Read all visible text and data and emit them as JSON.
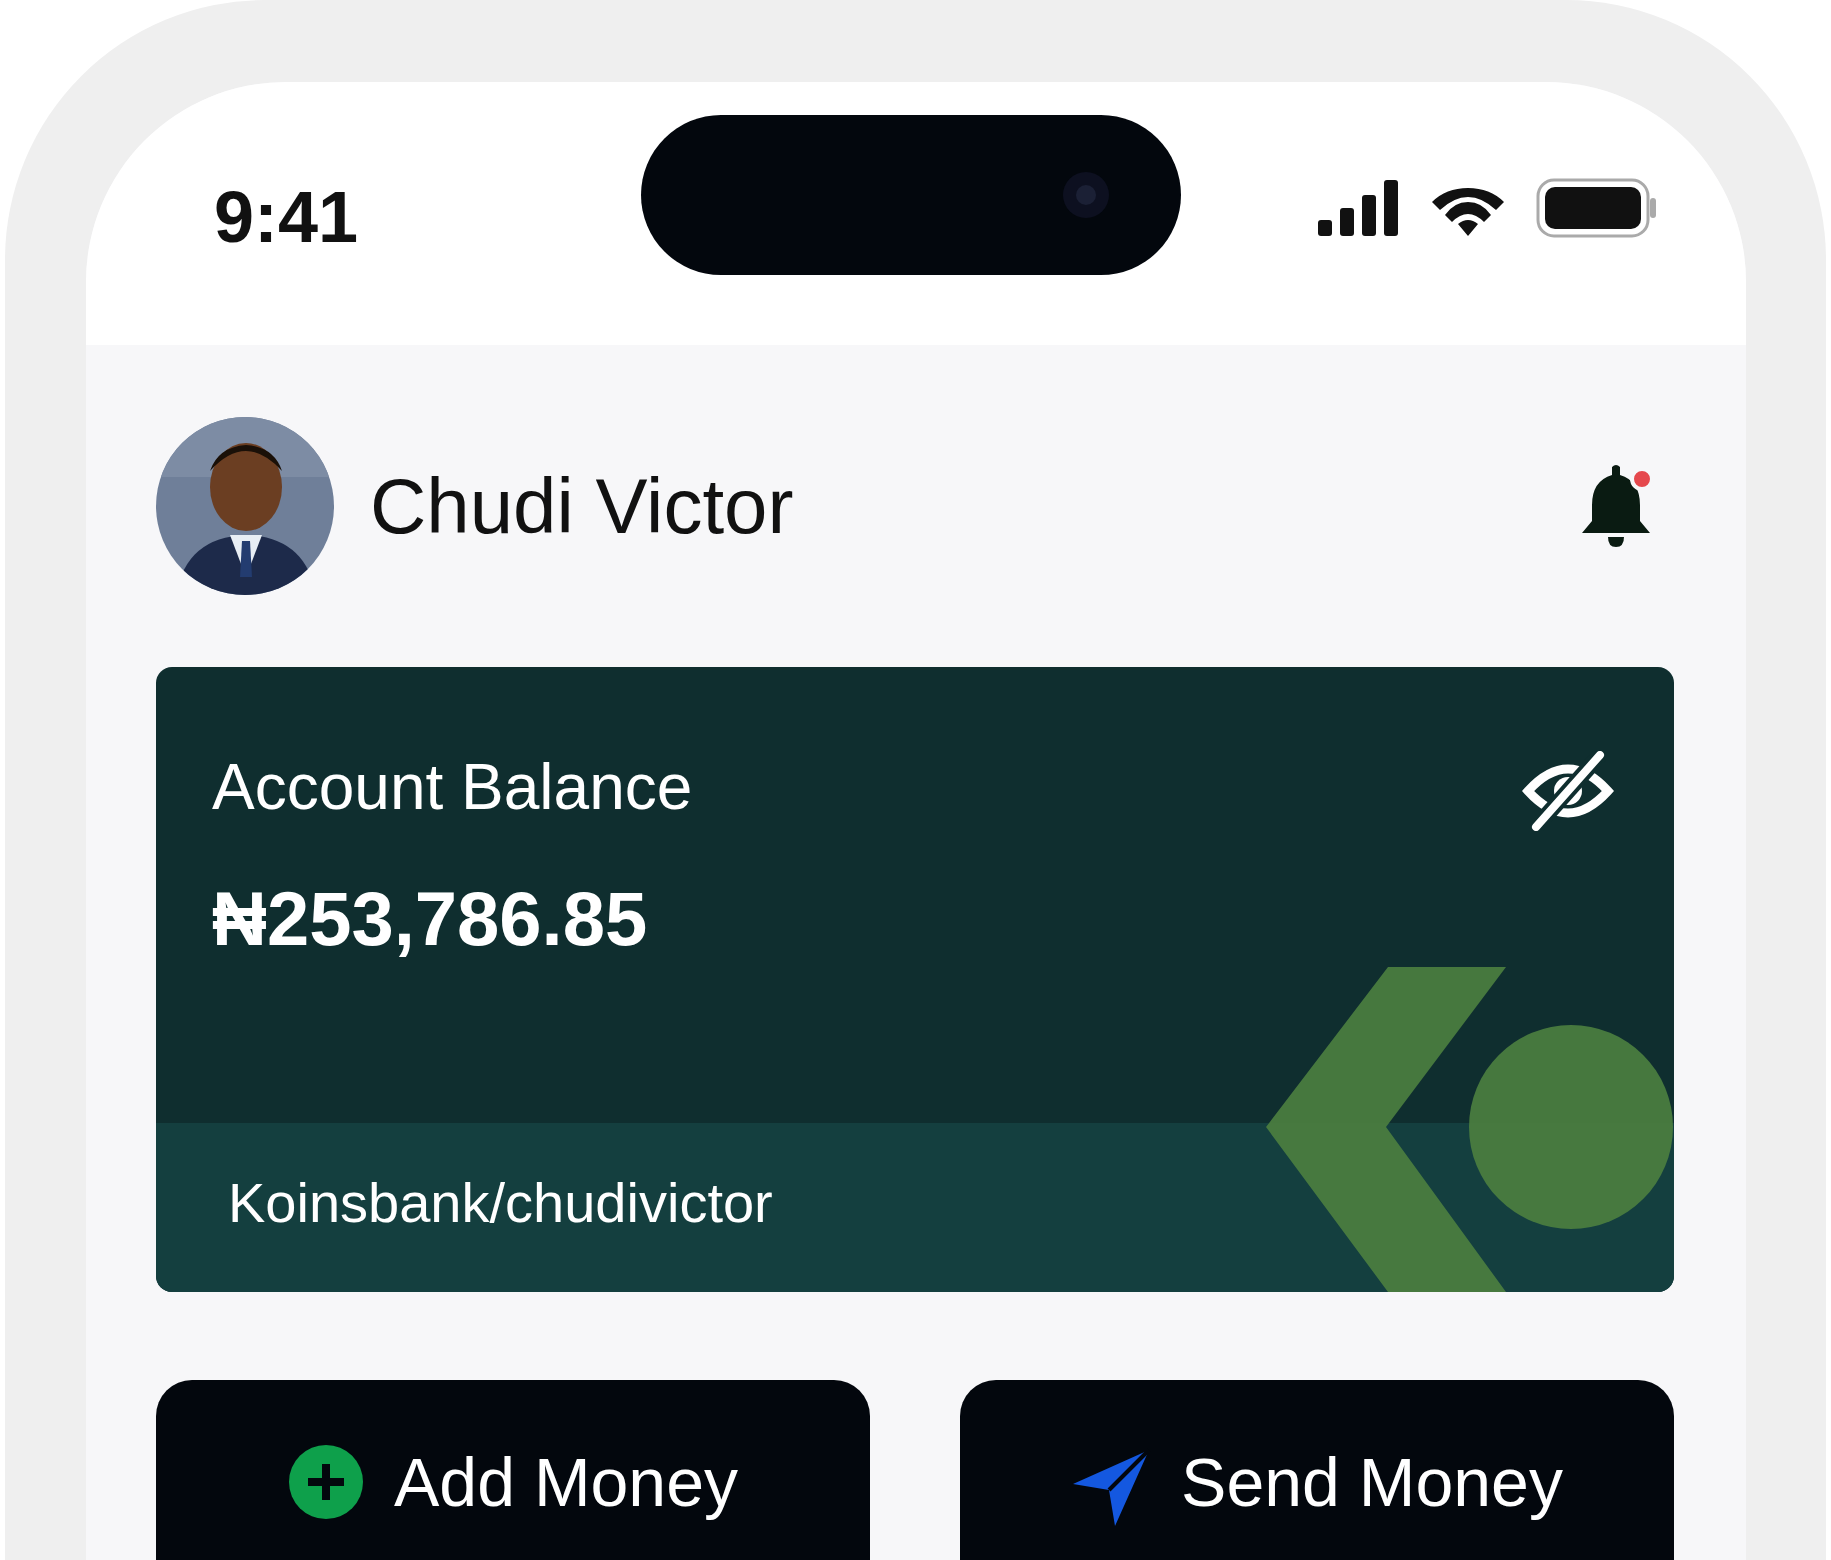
{
  "status_bar": {
    "time": "9:41"
  },
  "header": {
    "name": "Chudi Victor",
    "notifications": {
      "unread": true
    }
  },
  "balance_card": {
    "title": "Account Balance",
    "amount": "₦253,786.85",
    "account_tag": "Koinsbank/chudivictor"
  },
  "actions": [
    {
      "label": "Add Money",
      "kind": "add"
    },
    {
      "label": "Send Money",
      "kind": "send"
    }
  ]
}
